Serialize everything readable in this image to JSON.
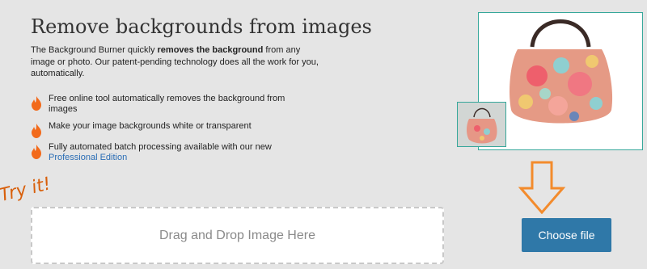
{
  "header": {
    "title": "Remove backgrounds from images"
  },
  "intro": {
    "before": "The Background Burner quickly ",
    "bold": "removes the background",
    "after": " from any image or photo. Our patent-pending technology does all the work for you, automatically."
  },
  "features": [
    {
      "text": "Free online tool automatically removes the background from images",
      "link": ""
    },
    {
      "text": "Make your image backgrounds white or transparent",
      "link": ""
    },
    {
      "text": "Fully automated batch processing available with our new ",
      "link": "Professional Edition"
    }
  ],
  "try_label": "Try it!",
  "dropzone": {
    "label": "Drag and Drop Image Here"
  },
  "upload": {
    "button_label": "Choose file"
  },
  "colors": {
    "accent": "#2f78a8",
    "flame": "#f26a1b",
    "arrow": "#f38b2c",
    "frame": "#36a79a",
    "link": "#2a6db5"
  },
  "icons": {
    "feature": "flame-icon",
    "arrow": "down-arrow-icon",
    "preview": "handbag-photo"
  }
}
